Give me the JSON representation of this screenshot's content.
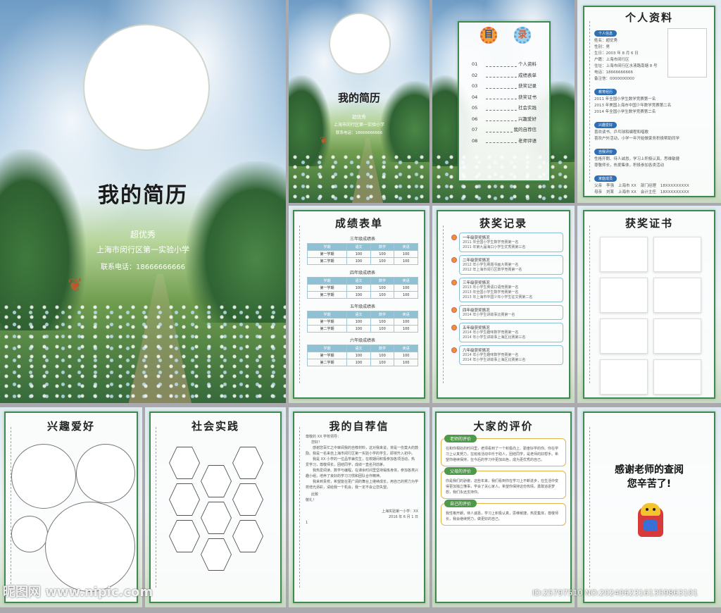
{
  "cover": {
    "title": "我的简历",
    "name": "超优秀",
    "school": "上海市闵行区第一实验小学",
    "phone": "联系电话：18666666666"
  },
  "cover_small": {
    "title": "我的简历",
    "name": "超优秀",
    "school": "上海市闵行区第一实验小学",
    "phone": "联系电话：18666666666"
  },
  "toc": {
    "badge1": "目",
    "badge2": "录",
    "items": [
      {
        "num": "01",
        "label": "个人资料"
      },
      {
        "num": "02",
        "label": "成绩表单"
      },
      {
        "num": "03",
        "label": "获奖记录"
      },
      {
        "num": "04",
        "label": "获奖证书"
      },
      {
        "num": "05",
        "label": "社会实践"
      },
      {
        "num": "06",
        "label": "兴趣爱好"
      },
      {
        "num": "07",
        "label": "我的自荐信"
      },
      {
        "num": "08",
        "label": "老师评语"
      }
    ]
  },
  "profile": {
    "title": "个人资料",
    "sec_info": "个人信息",
    "info_lines": [
      "姓名：超优秀",
      "性别：男",
      "生日：2003 年 8 月 6 日",
      "户籍：上海市闵行区",
      "住址：上海市闵行区水清路南塘 8 号",
      "电话：18666666666",
      "备注信：0000000000"
    ],
    "sec_edu": "教育经历",
    "edu_lines": [
      "2011 年全国小学生数学竞赛第一名",
      "2013 年美国上海市中国少年数学竞赛第二名",
      "2014 年全国小学生数学竞赛第二名"
    ],
    "sec_skill": "兴趣爱好",
    "skill_lines": [
      "喜欢读书、乒乓球和编程和唱歌",
      "喜欢户外活动，小学一年开始做家务积极帮助同学"
    ],
    "sec_self": "自我评价",
    "self_lines": [
      "性格开朗、待人诚恳，学习上积极认真，思维敏捷",
      "尊敬师长，热爱集体，积极参加各类活动"
    ],
    "sec_family": "家庭成员",
    "family": [
      {
        "rel": "父亲",
        "name": "李强",
        "place": "上海市 XX",
        "job": "部门经理",
        "phone": "18XXXXXXXXX"
      },
      {
        "rel": "母亲",
        "name": "刘某",
        "place": "上海市 XX",
        "job": "会计主任",
        "phone": "18XXXXXXXXX"
      }
    ]
  },
  "grades": {
    "title": "成绩表单",
    "header": [
      "学期",
      "语文",
      "数学",
      "英语"
    ],
    "blocks": [
      {
        "label": "三年级成绩表",
        "rows": [
          [
            "第一学期",
            "100",
            "100",
            "100"
          ],
          [
            "第二学期",
            "100",
            "100",
            "100"
          ]
        ]
      },
      {
        "label": "四年级成绩表",
        "rows": [
          [
            "第一学期",
            "100",
            "100",
            "100"
          ],
          [
            "第二学期",
            "100",
            "100",
            "100"
          ]
        ]
      },
      {
        "label": "五年级成绩表",
        "rows": [
          [
            "第一学期",
            "100",
            "100",
            "100"
          ],
          [
            "第二学期",
            "100",
            "100",
            "100"
          ]
        ]
      },
      {
        "label": "六年级成绩表",
        "rows": [
          [
            "第一学期",
            "100",
            "100",
            "100"
          ],
          [
            "第二学期",
            "100",
            "100",
            "100"
          ]
        ]
      }
    ]
  },
  "awards": {
    "title": "获奖记录",
    "items": [
      {
        "title": "一年级获奖情况",
        "lines": [
          "2011 年全国小学生数学竞赛第一名",
          "2011 年第九届海口小学生优秀赛第三名"
        ]
      },
      {
        "title": "二年级获奖情况",
        "lines": [
          "2012 年小学生刷题书画大赛第一名",
          "2012 年上海市闵行区数学竞赛第一名"
        ]
      },
      {
        "title": "三年级获奖情况",
        "lines": [
          "2013 年小学生英语口语竞赛第一名",
          "2013 年全国小学生数学竞赛第一名",
          "2013 年上海市中国少年小学生征文赛第二名"
        ]
      },
      {
        "title": "四年级获奖情况",
        "lines": [
          "2014 年小学生讲故事比赛第一名"
        ]
      },
      {
        "title": "五年级获奖情况",
        "lines": [
          "2014 年小学生趣味数学竞赛第一名",
          "2014 年小学生讲故事上海区比赛第三名"
        ]
      },
      {
        "title": "六年级获奖情况",
        "lines": [
          "2014 年小学生趣味数学竞赛第一名",
          "2014 年小学生讲故事上海区比赛第三名"
        ]
      }
    ]
  },
  "certs": {
    "title": "获奖证书"
  },
  "hobby": {
    "title": "兴趣爱好"
  },
  "practice": {
    "title": "社会实践"
  },
  "letter": {
    "title": "我的自荐信",
    "greeting": "尊敬的 XX 学校领导：",
    "salutation": "您好！",
    "paras": [
      "感谢您百忙之中审阅我的自荐材料，这对我来说，将是一份莫大的鼓励。我是一名来自上海市闵行区第一实验小学的学生，即将升入初中。",
      "我是 XX 小学的一位品学兼优生，在校期间积极参加各项活动，热爱学习，尊敬师长，团结同学，成绩一直名列前茅。",
      "我热爱阅读、数学与编程，在课余时间里坚持锻炼身体，参加各类兴趣小组，培养了良好的学习习惯和团队合作精神。",
      "我来到贵校，希望能在更广阔的舞台上继续成长，用自己的努力为学校增光添彩，请给我一个机会，我一定不会让您失望。"
    ],
    "closing": "此致",
    "regards": "敬礼！",
    "signature": "上海实验第一小学：XX",
    "date": "2016 年 6 月 1 日",
    "page_no": "1"
  },
  "reviews": {
    "title": "大家的评价",
    "items": [
      {
        "tag": "老师的评价",
        "text": "在和你相处的时间里，老师看到了一个积极向上、勤奋好学的你。你在学习上认真努力，在班级活动中乐于助人，团结同学，是老师的好帮手。希望你继续保持，在今后的学习中更加出色，成为更优秀的自己。"
      },
      {
        "tag": "父母的评价",
        "text": "你是我们的骄傲，这些年来，我们看到你在学习上不断进步，在生活中变得更加独立懂事，学会了关心家人。希望你保持这份热情，勇敢追逐梦想，我们永远支持你。"
      },
      {
        "tag": "自己的评价",
        "text": "我性格开朗，待人诚恳，学习上积极认真，思维敏捷，热爱集体，尊敬师长，我会继续努力，做更好的自己。"
      }
    ]
  },
  "thanks": {
    "line1": "感谢老师的查阅",
    "line2": "您辛苦了!"
  },
  "watermark": {
    "left": "昵图网 www.nipic.com",
    "right": "ID:25797510 NO:20240623161359863101"
  }
}
